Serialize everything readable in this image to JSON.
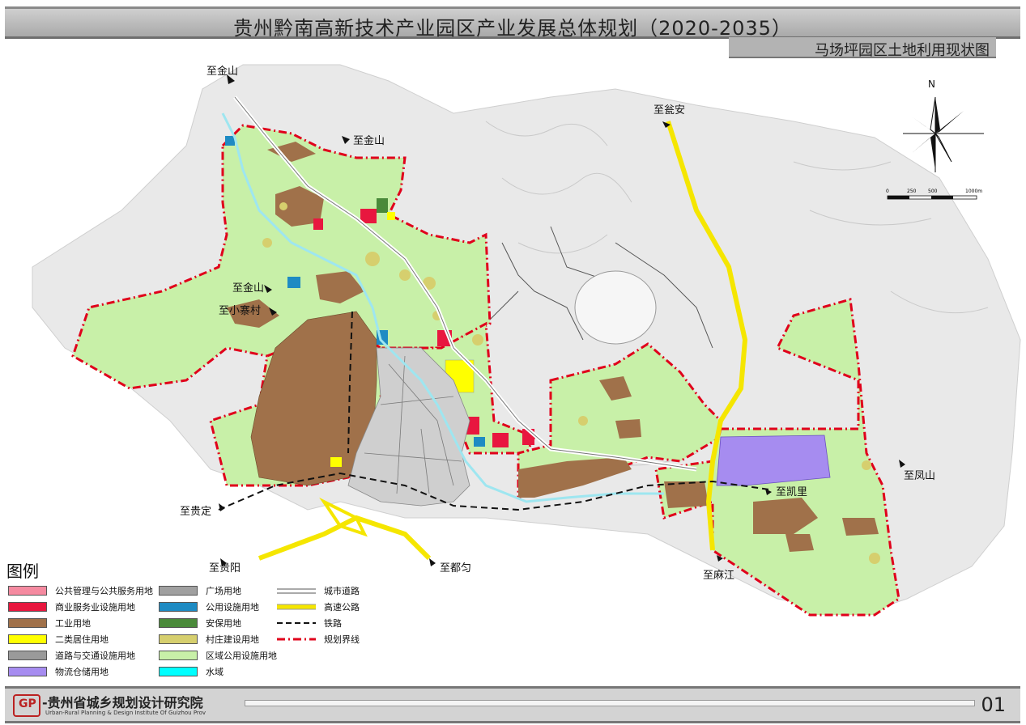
{
  "header": {
    "title": "贵州黔南高新技术产业园区产业发展总体规划（2020-2035）",
    "subtitle": "马场坪园区土地利用现状图"
  },
  "map": {
    "directions": {
      "jinshan_top": "至金山",
      "jinshan_mid": "至金山",
      "jinshan_left": "至金山",
      "xiaozhaicun": "至小寨村",
      "wengan": "至瓮安",
      "guiding": "至贵定",
      "guiyang": "至贵阳",
      "duyun": "至都匀",
      "kaili": "至凯里",
      "fengshan": "至凤山",
      "majiang": "至麻江"
    },
    "compass_label": "N",
    "scale_ticks": [
      "0",
      "250",
      "500",
      "1000m"
    ],
    "colors": {
      "boundary": "#e0001b",
      "regional": "#c8f0a8",
      "industrial": "#a0714a",
      "logistics": "#a68cf0",
      "highway": "#f5e600",
      "commercial": "#e8173f",
      "utility": "#1e8bc3",
      "security": "#4a8a3a",
      "village": "#d6cf6e",
      "residential": "#ffff00",
      "water": "#9ee6f0"
    }
  },
  "legend": {
    "title": "图例",
    "items": [
      {
        "label": "公共管理与公共服务用地",
        "color": "#f58aa0"
      },
      {
        "label": "商业服务业设施用地",
        "color": "#e8173f"
      },
      {
        "label": "工业用地",
        "color": "#a0714a"
      },
      {
        "label": "二类居住用地",
        "color": "#ffff00"
      },
      {
        "label": "道路与交通设施用地",
        "color": "#9a9a9a"
      },
      {
        "label": "物流仓储用地",
        "color": "#a68cf0"
      },
      {
        "label": "广场用地",
        "color": "#a0a0a0"
      },
      {
        "label": "公用设施用地",
        "color": "#1e8bc3"
      },
      {
        "label": "安保用地",
        "color": "#4a8a3a"
      },
      {
        "label": "村庄建设用地",
        "color": "#d6cf6e"
      },
      {
        "label": "区域公用设施用地",
        "color": "#c8f0a8"
      },
      {
        "label": "水域",
        "color": "#00ffff"
      }
    ],
    "lines": [
      {
        "label": "城市道路"
      },
      {
        "label": "高速公路"
      },
      {
        "label": "铁路"
      },
      {
        "label": "规划界线"
      }
    ]
  },
  "footer": {
    "logo_text": "GP",
    "org_name": "-贵州省城乡规划设计研究院",
    "org_en": "Urban-Rural Planning & Design Institute Of Guizhou Prov",
    "page_number": "01"
  }
}
